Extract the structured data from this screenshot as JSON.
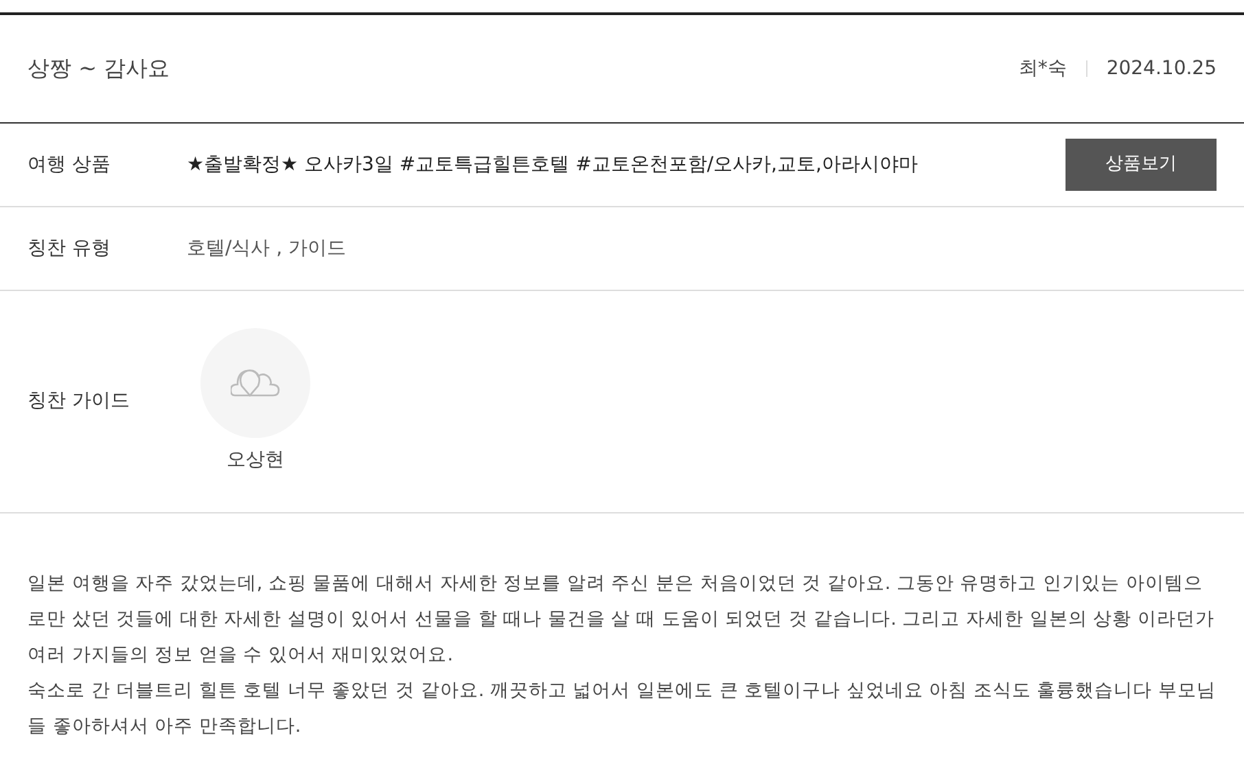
{
  "review": {
    "title": "상짱 ~ 감사요",
    "author": "최*숙",
    "date": "2024.10.25"
  },
  "product": {
    "label": "여행 상품",
    "value": "★출발확정★ 오사카3일 #교토특급힐튼호텔 #교토온천포함/오사카,교토,아라시야마",
    "button": "상품보기"
  },
  "praise_type": {
    "label": "칭찬 유형",
    "value": "호텔/식사 , 가이드"
  },
  "praise_guide": {
    "label": "칭찬 가이드",
    "guides": [
      {
        "name": "오상현"
      }
    ]
  },
  "body": [
    "일본 여행을 자주 갔었는데, 쇼핑 물품에 대해서 자세한 정보를 알려 주신 분은 처음이었던 것 같아요. 그동안 유명하고 인기있는 아이템으로만 샀던 것들에 대한 자세한 설명이 있어서 선물을 할 때나 물건을 살 때 도움이 되었던 것 같습니다. 그리고 자세한 일본의 상황 이라던가 여러 가지들의 정보 얻을 수 있어서 재미있었어요.",
    "숙소로 간 더블트리 힐튼 호텔 너무 좋았던 것 같아요. 깨끗하고 넓어서 일본에도 큰 호텔이구나 싶었네요 아침 조식도 훌륭했습니다 부모님들 좋아하셔서 아주 만족합니다."
  ]
}
